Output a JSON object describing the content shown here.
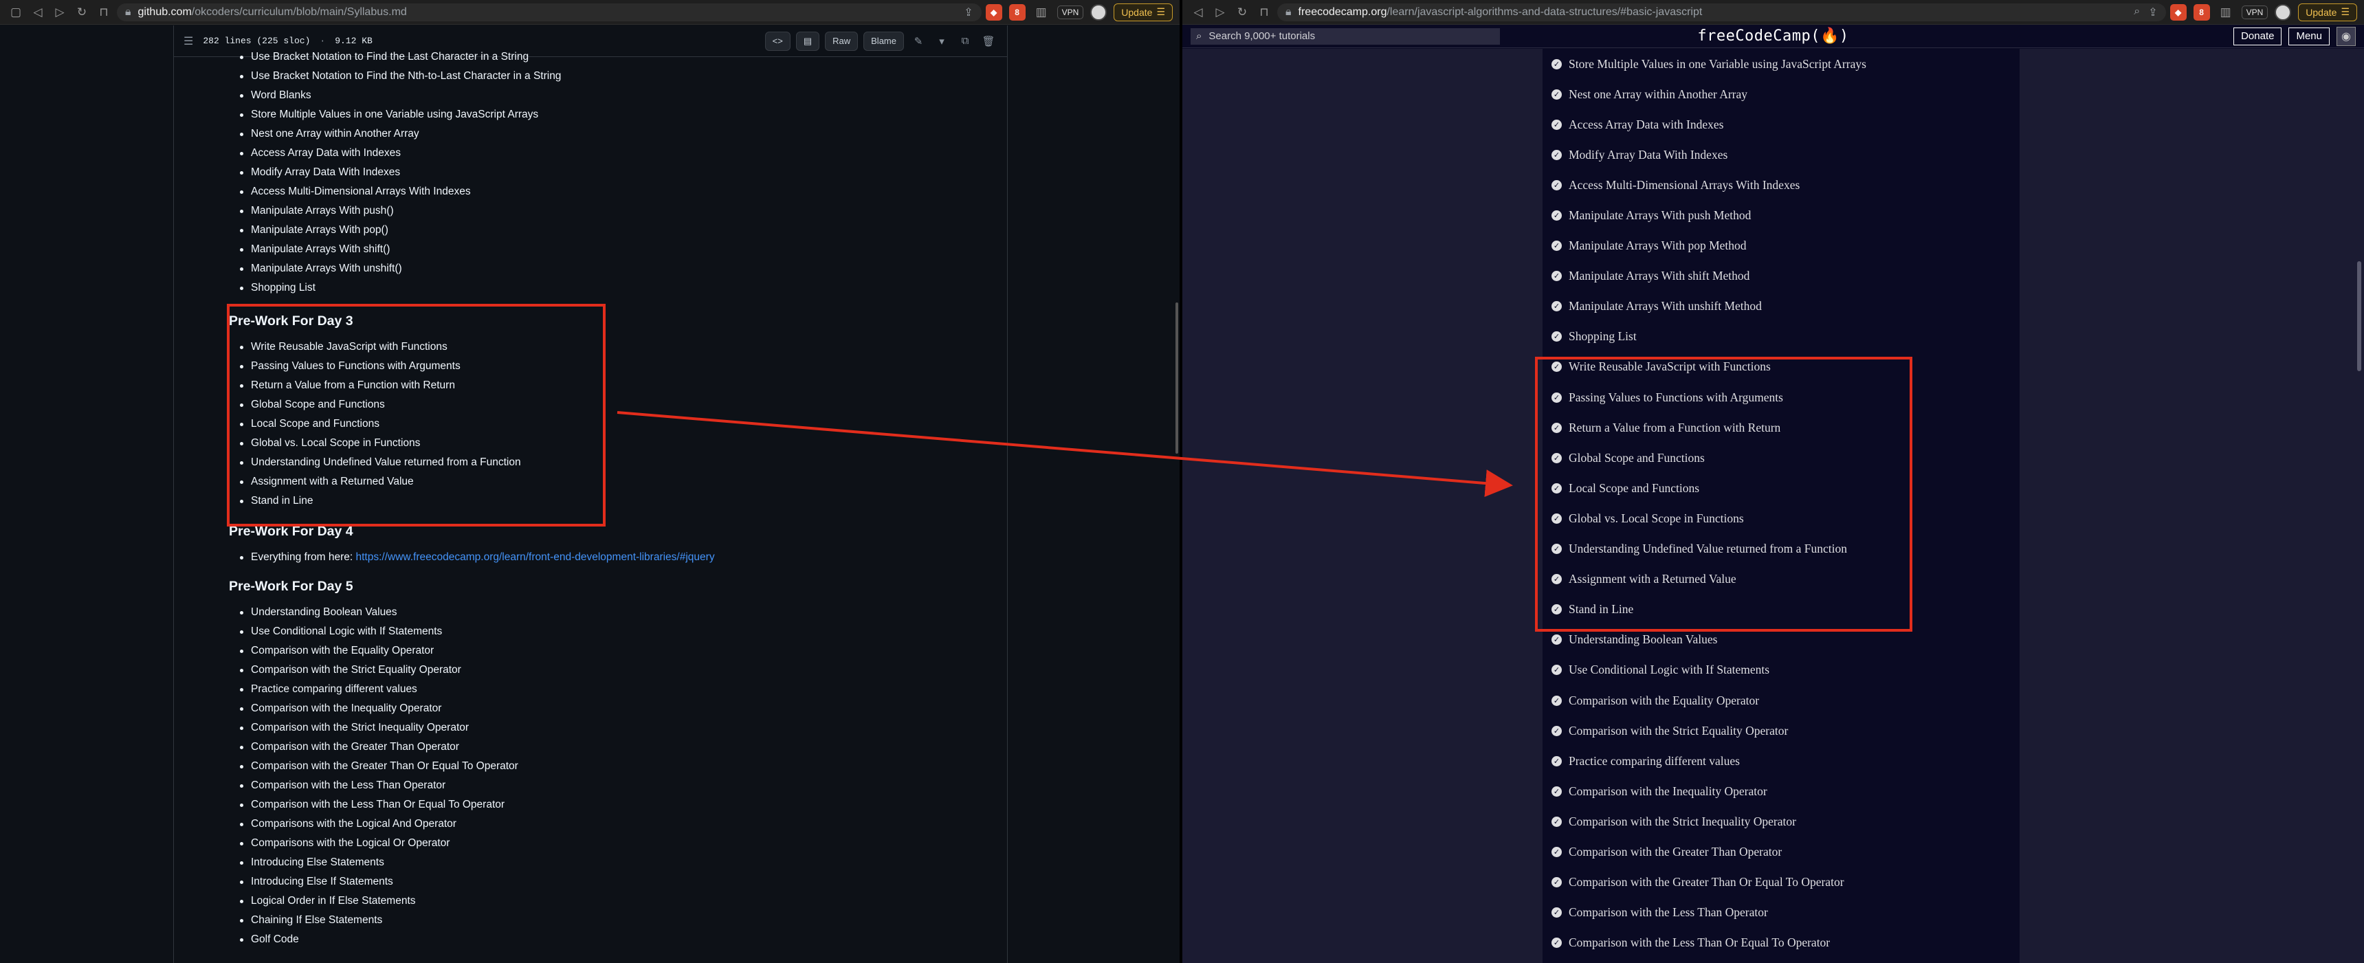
{
  "left_browser": {
    "url_host": "github.com",
    "url_path": "/okcoders/curriculum/blob/main/Syllabus.md",
    "vpn_label": "VPN",
    "update_label": "Update",
    "badge_1": "",
    "badge_2": "8"
  },
  "github": {
    "file_meta": "282 lines (225 sloc)",
    "file_size": "9.12 KB",
    "raw_label": "Raw",
    "blame_label": "Blame",
    "top_items": [
      "Use Bracket Notation to Find the Last Character in a String",
      "Use Bracket Notation to Find the Nth-to-Last Character in a String",
      "Word Blanks",
      "Store Multiple Values in one Variable using JavaScript Arrays",
      "Nest one Array within Another Array",
      "Access Array Data with Indexes",
      "Modify Array Data With Indexes",
      "Access Multi-Dimensional Arrays With Indexes",
      "Manipulate Arrays With push()",
      "Manipulate Arrays With pop()",
      "Manipulate Arrays With shift()",
      "Manipulate Arrays With unshift()",
      "Shopping List"
    ],
    "day3_heading": "Pre-Work For Day 3",
    "day3_items": [
      "Write Reusable JavaScript with Functions",
      "Passing Values to Functions with Arguments",
      "Return a Value from a Function with Return",
      "Global Scope and Functions",
      "Local Scope and Functions",
      "Global vs. Local Scope in Functions",
      "Understanding Undefined Value returned from a Function",
      "Assignment with a Returned Value",
      "Stand in Line"
    ],
    "day4_heading": "Pre-Work For Day 4",
    "day4_prefix": "Everything from here: ",
    "day4_link": "https://www.freecodecamp.org/learn/front-end-development-libraries/#jquery",
    "day5_heading": "Pre-Work For Day 5",
    "day5_items": [
      "Understanding Boolean Values",
      "Use Conditional Logic with If Statements",
      "Comparison with the Equality Operator",
      "Comparison with the Strict Equality Operator",
      "Practice comparing different values",
      "Comparison with the Inequality Operator",
      "Comparison with the Strict Inequality Operator",
      "Comparison with the Greater Than Operator",
      "Comparison with the Greater Than Or Equal To Operator",
      "Comparison with the Less Than Operator",
      "Comparison with the Less Than Or Equal To Operator",
      "Comparisons with the Logical And Operator",
      "Comparisons with the Logical Or Operator",
      "Introducing Else Statements",
      "Introducing Else If Statements",
      "Logical Order in If Else Statements",
      "Chaining If Else Statements",
      "Golf Code"
    ]
  },
  "right_browser": {
    "url_host": "freecodecamp.org",
    "url_path": "/learn/javascript-algorithms-and-data-structures/#basic-javascript",
    "vpn_label": "VPN",
    "update_label": "Update",
    "badge_2": "8"
  },
  "fcc": {
    "search_placeholder": "Search 9,000+ tutorials",
    "logo": "freeCodeCamp(🔥)",
    "donate_label": "Donate",
    "menu_label": "Menu",
    "items": [
      "Store Multiple Values in one Variable using JavaScript Arrays",
      "Nest one Array within Another Array",
      "Access Array Data with Indexes",
      "Modify Array Data With Indexes",
      "Access Multi-Dimensional Arrays With Indexes",
      "Manipulate Arrays With push Method",
      "Manipulate Arrays With pop Method",
      "Manipulate Arrays With shift Method",
      "Manipulate Arrays With unshift Method",
      "Shopping List",
      "Write Reusable JavaScript with Functions",
      "Passing Values to Functions with Arguments",
      "Return a Value from a Function with Return",
      "Global Scope and Functions",
      "Local Scope and Functions",
      "Global vs. Local Scope in Functions",
      "Understanding Undefined Value returned from a Function",
      "Assignment with a Returned Value",
      "Stand in Line",
      "Understanding Boolean Values",
      "Use Conditional Logic with If Statements",
      "Comparison with the Equality Operator",
      "Comparison with the Strict Equality Operator",
      "Practice comparing different values",
      "Comparison with the Inequality Operator",
      "Comparison with the Strict Inequality Operator",
      "Comparison with the Greater Than Operator",
      "Comparison with the Greater Than Or Equal To Operator",
      "Comparison with the Less Than Operator",
      "Comparison with the Less Than Or Equal To Operator"
    ]
  },
  "colors": {
    "annotation": "#e22d1c",
    "github_bg": "#0d1117",
    "fcc_bg": "#0a0a23"
  }
}
